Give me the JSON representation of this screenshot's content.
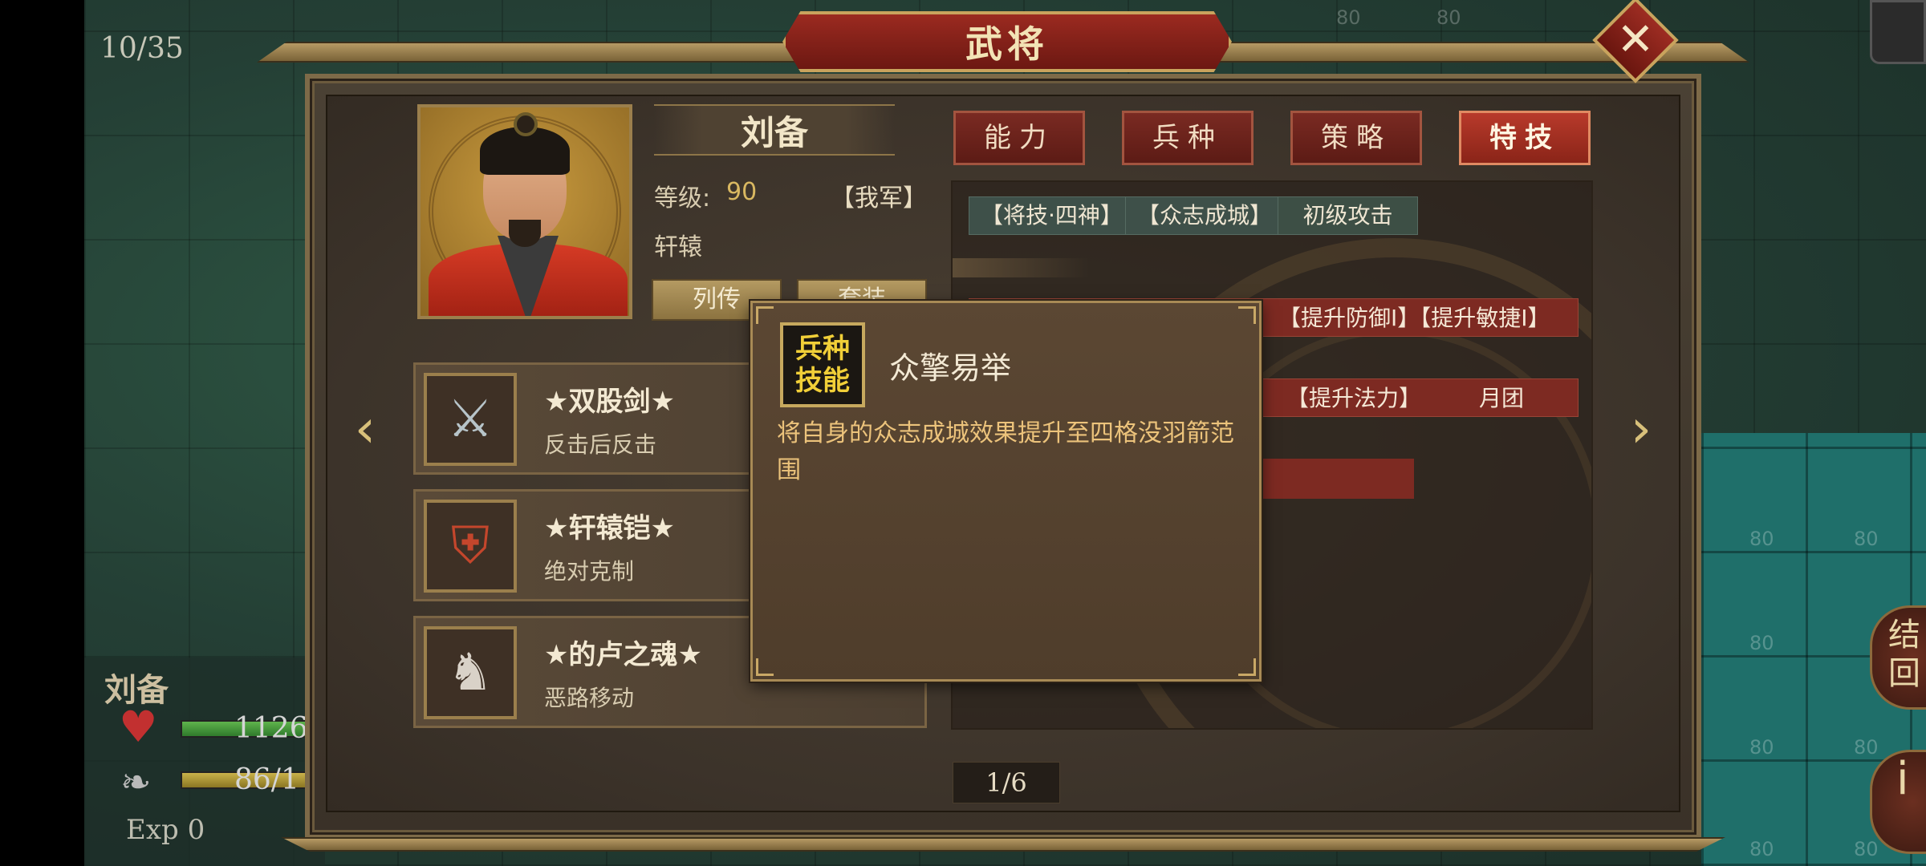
{
  "map": {
    "turn_counter": "10/35",
    "tile_values": [
      "80",
      "80",
      "80",
      "80",
      "80",
      "80",
      "80",
      "80",
      "80"
    ]
  },
  "unit_card": {
    "name": "刘备",
    "hp_text": "1126",
    "mp_text": "86/1",
    "exp_text": "Exp 0"
  },
  "right_buttons": {
    "end_turn_label": "结\n回",
    "info_label": "i"
  },
  "dialog": {
    "title": "武将",
    "close_icon": "✕"
  },
  "general": {
    "name": "刘备",
    "level_label": "等级:",
    "level_value": "90",
    "faction": "【我军】",
    "class": "轩辕",
    "biography_button": "列传",
    "set_button": "套装"
  },
  "equipment": [
    {
      "name": "★双股剑★",
      "effect": "反击后反击",
      "icon": "sword-icon"
    },
    {
      "name": "★轩辕铠★",
      "effect": "绝对克制",
      "icon": "armor-icon"
    },
    {
      "name": "★的卢之魂★",
      "effect": "恶路移动",
      "icon": "horse-icon"
    }
  ],
  "tabs": [
    {
      "label": "能力",
      "active": false
    },
    {
      "label": "兵种",
      "active": false
    },
    {
      "label": "策略",
      "active": false
    },
    {
      "label": "特技",
      "active": true
    }
  ],
  "skills": {
    "chips": [
      "【将技·四神】",
      "【众志成城】",
      "初级攻击"
    ],
    "buffs_row1": "【提升防御Ⅰ】【提升敏捷Ⅰ】",
    "buffs_row2_a": "【提升法力】",
    "buffs_row2_b": "月团"
  },
  "pagination": "1/6",
  "tooltip": {
    "icon_line1": "兵种",
    "icon_line2": "技能",
    "title": "众擎易举",
    "description": "将自身的众志成城效果提升至四格没羽箭范围"
  },
  "colors": {
    "tab_active": "#b83a2b",
    "tab_inactive": "#7a2a22",
    "tooltip_text": "#ecc37b",
    "icon_text": "#f1cf38",
    "level_value": "#d9b861"
  }
}
